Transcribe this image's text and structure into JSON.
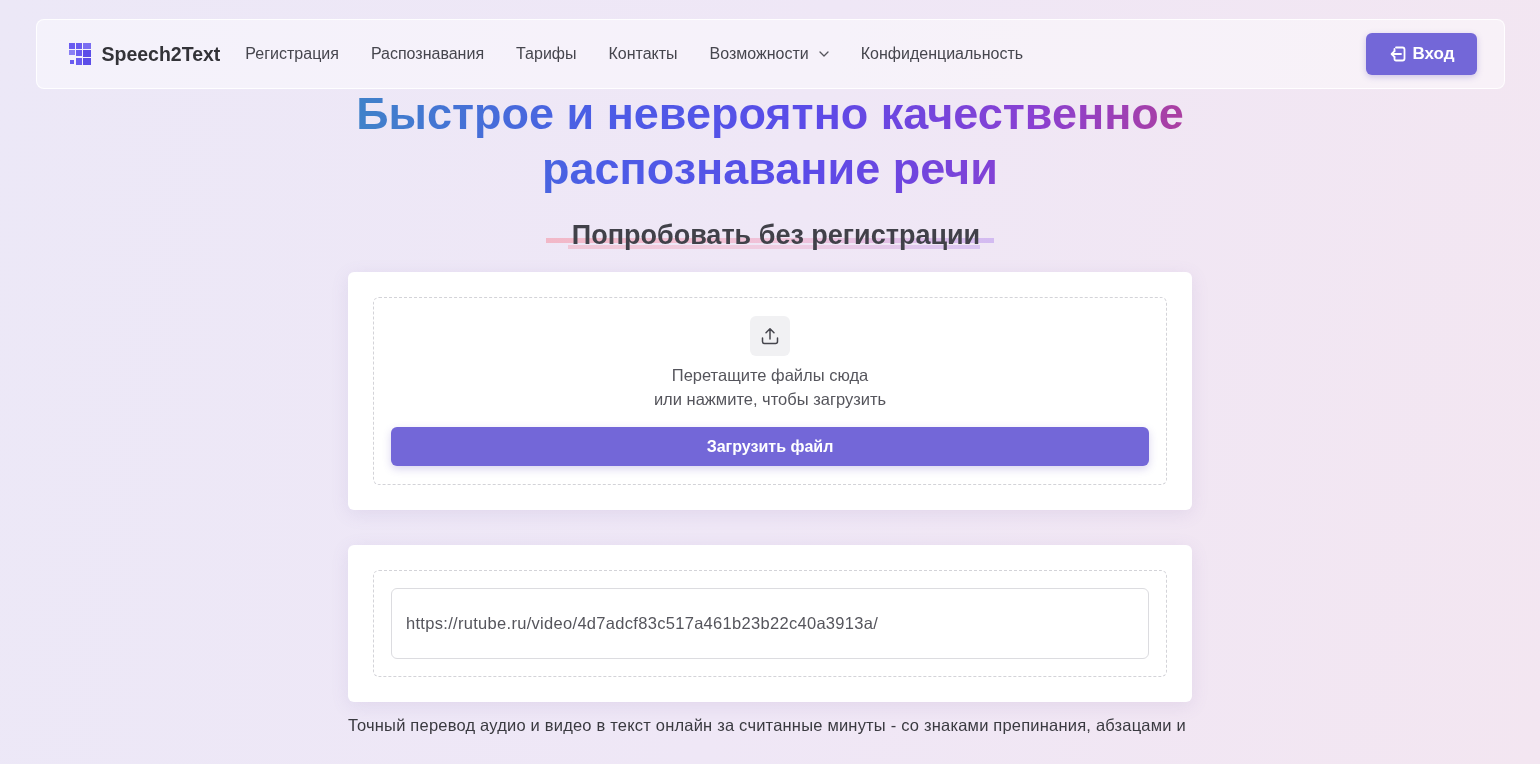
{
  "header": {
    "logo": {
      "text": "Speech2Text"
    },
    "nav": [
      {
        "label": "Регистрация",
        "kind": "link"
      },
      {
        "label": "Распознавания",
        "kind": "link"
      },
      {
        "label": "Тарифы",
        "kind": "link"
      },
      {
        "label": "Контакты",
        "kind": "link"
      },
      {
        "label": "Возможности",
        "kind": "dropdown"
      },
      {
        "label": "Конфиденциальность",
        "kind": "link"
      }
    ],
    "login_button": {
      "label": "Вход"
    }
  },
  "hero": {
    "title": "Быстрое и невероятно качественное распознавание речи",
    "subtitle": "Попробовать без регистрации"
  },
  "upload_card": {
    "hint_lines": [
      "Перетащите файлы сюда",
      "или нажмите, чтобы загрузить"
    ],
    "button": "Загрузить файл"
  },
  "link_card": {
    "url_field": {
      "value": "https://rutube.ru/video/4d7adcf83c517a461b23b22c40a3913a/"
    }
  },
  "description": "Точный перевод аудио и видео в текст онлайн за считанные минуты - со знаками препинания, абзацами и"
}
